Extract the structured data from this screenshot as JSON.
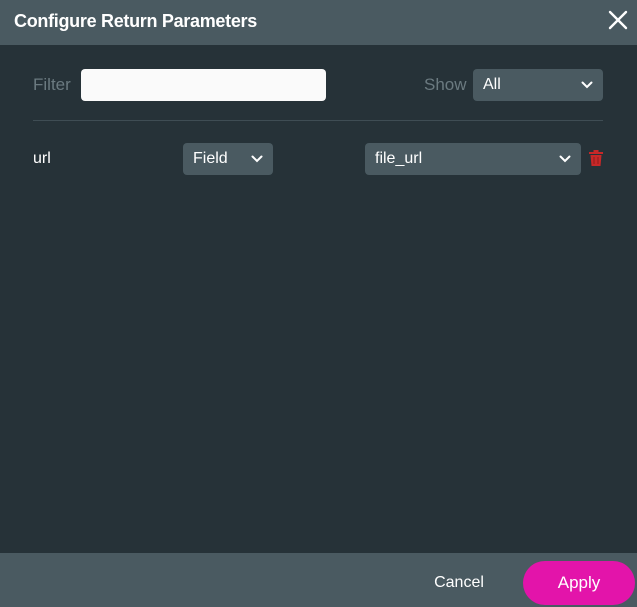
{
  "dialog": {
    "title": "Configure Return Parameters",
    "close_icon": "close-icon"
  },
  "toolbar": {
    "filter_label": "Filter",
    "filter_value": "",
    "show_label": "Show",
    "show_value": "All"
  },
  "rows": [
    {
      "name": "url",
      "type": "Field",
      "value": "file_url",
      "delete_icon": "trash-icon"
    }
  ],
  "footer": {
    "cancel_label": "Cancel",
    "apply_label": "Apply"
  },
  "colors": {
    "accent": "#e314aa",
    "delete": "#c62828",
    "background": "#263238",
    "panel": "#4a5a61"
  }
}
